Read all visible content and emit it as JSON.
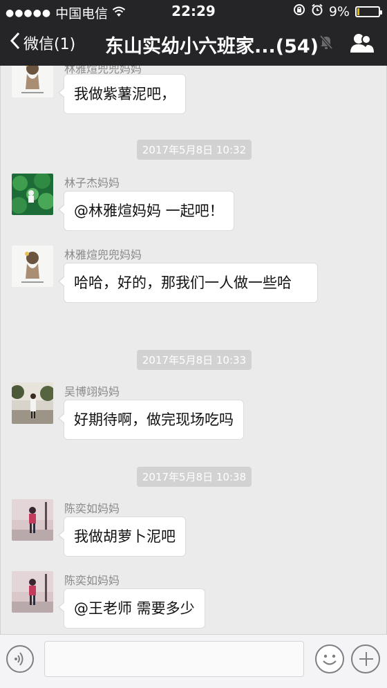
{
  "status_bar": {
    "signal_dots": "●●●●●",
    "carrier": "中国电信",
    "time": "22:29",
    "battery_text": "9%",
    "battery_level": 0.09,
    "battery_color": "#e6b800",
    "icons": [
      "signal-icon",
      "wifi-icon",
      "rotation-lock-icon",
      "alarm-icon",
      "battery-icon"
    ]
  },
  "nav": {
    "back_label": "微信(1)",
    "title": "东山实幼小六班家...(54)",
    "icons": [
      "back-chevron-icon",
      "mute-bell-icon",
      "group-members-icon"
    ]
  },
  "chat": {
    "partial_message": {
      "sender": "林雅煊兜兜妈妈",
      "text": "我做紫薯泥吧，",
      "avatar": "cartoon-girl-avatar"
    },
    "timestamp_1": "2017年5月8日 10:32",
    "message_1": {
      "sender": "林子杰妈妈",
      "text": "@林雅煊妈妈 一起吧！",
      "avatar": "green-leaves-avatar"
    },
    "message_2": {
      "sender": "林雅煊兜兜妈妈",
      "text": "哈哈，好的，那我们一人做一些哈",
      "avatar": "cartoon-girl-avatar"
    },
    "timestamp_2": "2017年5月8日 10:33",
    "message_3": {
      "sender": "吴博翊妈妈",
      "text": "好期待啊，做完现场吃吗",
      "avatar": "outdoor-photo-avatar"
    },
    "timestamp_3": "2017年5月8日 10:38",
    "message_4": {
      "sender": "陈奕如妈妈",
      "text": "我做胡萝卜泥吧",
      "avatar": "street-photo-avatar"
    },
    "message_5": {
      "sender": "陈奕如妈妈",
      "text": "@王老师 需要多少",
      "avatar": "street-photo-avatar"
    }
  },
  "input_bar": {
    "value": "",
    "placeholder": "",
    "icons": [
      "voice-icon",
      "emoji-icon",
      "plus-icon"
    ]
  }
}
